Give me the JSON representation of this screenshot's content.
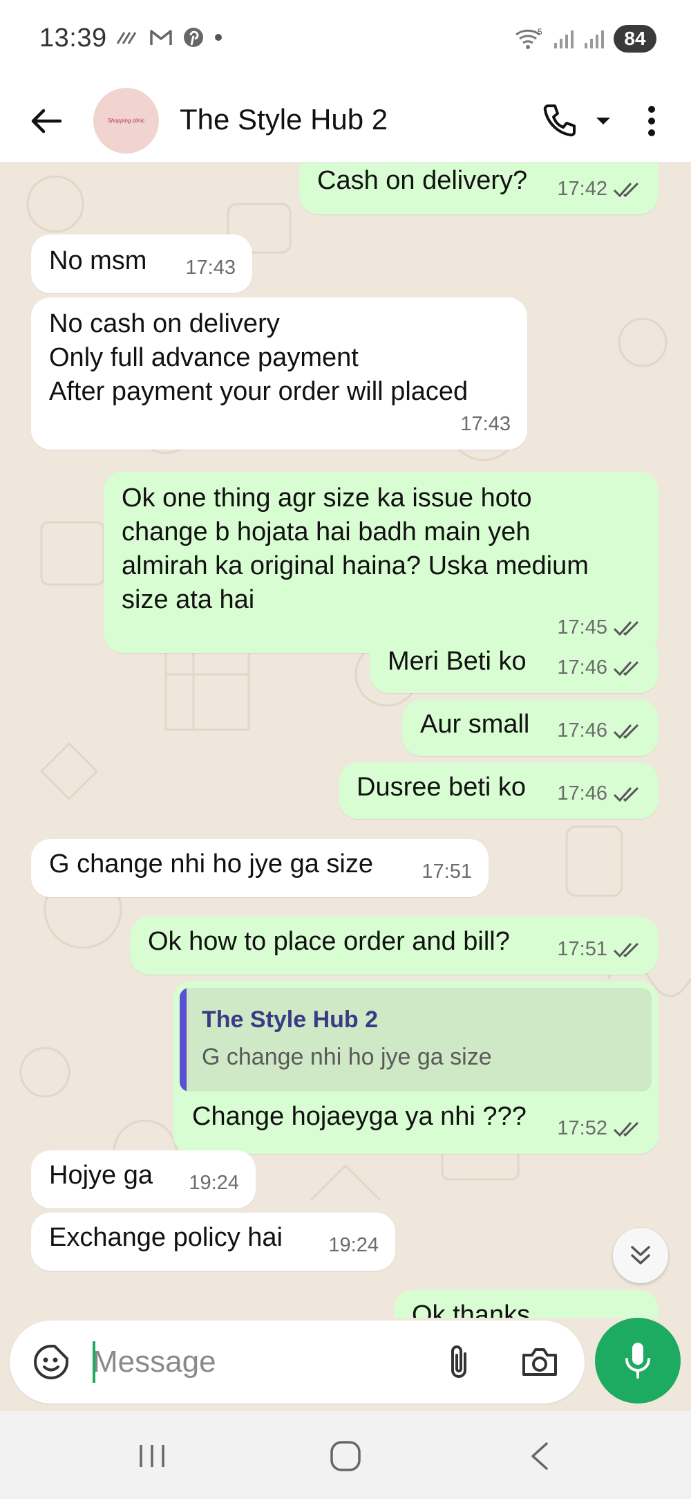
{
  "status_bar": {
    "time": "13:39",
    "battery": "84",
    "network_label": "5"
  },
  "header": {
    "contact_name": "The Style Hub 2",
    "avatar_text": "Shopping clinic"
  },
  "messages": [
    {
      "direction": "out",
      "text": "Cash on delivery?",
      "time": "17:42",
      "status": "read"
    },
    {
      "direction": "in",
      "text": "No msm",
      "time": "17:43"
    },
    {
      "direction": "in",
      "text": "No cash on delivery\nOnly full advance payment\nAfter payment your order will placed",
      "time": "17:43"
    },
    {
      "direction": "out",
      "text": "Ok one thing agr size ka issue hoto\nchange b hojata hai badh main yeh\nalmirah ka original haina? Uska medium\nsize ata hai",
      "time": "17:45",
      "status": "read"
    },
    {
      "direction": "out",
      "text": "Meri Beti ko",
      "time": "17:46",
      "status": "read"
    },
    {
      "direction": "out",
      "text": "Aur small",
      "time": "17:46",
      "status": "read"
    },
    {
      "direction": "out",
      "text": "Dusree beti ko",
      "time": "17:46",
      "status": "read"
    },
    {
      "direction": "in",
      "text": "G change nhi ho jye ga size",
      "time": "17:51"
    },
    {
      "direction": "out",
      "text": "Ok how to place order and bill?",
      "time": "17:51",
      "status": "read"
    },
    {
      "direction": "out",
      "text": "Change hojaeyga ya nhi ???",
      "time": "17:52",
      "status": "read",
      "quote": {
        "name": "The Style Hub 2",
        "text": "G change nhi ho jye ga size"
      }
    },
    {
      "direction": "in",
      "text": "Hojye ga",
      "time": "19:24"
    },
    {
      "direction": "in",
      "text": "Exchange policy hai",
      "time": "19:24"
    },
    {
      "direction": "out",
      "text": "Ok thanks",
      "time": "",
      "status": "read"
    }
  ],
  "composer": {
    "placeholder": "Message",
    "value": ""
  },
  "colors": {
    "accent": "#1daa61",
    "outgoing_bubble": "#d9fdd3",
    "incoming_bubble": "#ffffff",
    "chat_background": "#efe7dc",
    "quote_bar": "#5b4fd4"
  },
  "icons": {
    "back": "arrow-left-icon",
    "call": "phone-icon",
    "call_menu": "caret-down-icon",
    "menu": "kebab-menu-icon",
    "emoji": "sticker-icon",
    "attach": "paperclip-icon",
    "camera": "camera-icon",
    "mic": "microphone-icon",
    "scroll_down": "double-chevron-down-icon",
    "read_receipt": "double-check-icon"
  }
}
